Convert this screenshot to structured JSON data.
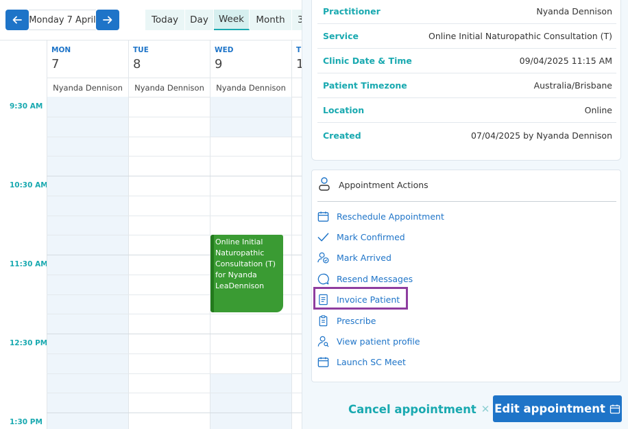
{
  "calendar": {
    "date_label": "Monday 7 April",
    "view_tabs": [
      "Today",
      "Day",
      "Week",
      "Month",
      "3"
    ],
    "active_tab": "Week",
    "days": [
      {
        "name": "MON",
        "num": "7",
        "practitioner": "Nyanda Dennison"
      },
      {
        "name": "TUE",
        "num": "8",
        "practitioner": "Nyanda Dennison"
      },
      {
        "name": "WED",
        "num": "9",
        "practitioner": "Nyanda Dennison"
      },
      {
        "name": "THU",
        "num": "1",
        "practitioner": ""
      }
    ],
    "times": [
      "9:30 AM",
      "10:30 AM",
      "11:30 AM",
      "12:30 PM",
      "1:30 PM"
    ],
    "appointment": {
      "text": "Online Initial Naturopathic Consultation (T) for Nyanda LeaDennison",
      "color": "#3a9b33"
    }
  },
  "details": {
    "rows": [
      {
        "label": "Practitioner",
        "value": "Nyanda Dennison"
      },
      {
        "label": "Service",
        "value": "Online Initial Naturopathic Consultation (T)"
      },
      {
        "label": "Clinic Date & Time",
        "value": "09/04/2025 11:15 AM"
      },
      {
        "label": "Patient Timezone",
        "value": "Australia/Brisbane"
      },
      {
        "label": "Location",
        "value": "Online"
      },
      {
        "label": "Created",
        "value": "07/04/2025 by Nyanda Dennison"
      }
    ]
  },
  "actions": {
    "title": "Appointment Actions",
    "items": [
      {
        "label": "Reschedule Appointment",
        "icon": "calendar-icon"
      },
      {
        "label": "Mark Confirmed",
        "icon": "check-icon"
      },
      {
        "label": "Mark Arrived",
        "icon": "user-check-icon"
      },
      {
        "label": "Resend Messages",
        "icon": "chat-bubble-icon"
      },
      {
        "label": "Invoice Patient",
        "icon": "invoice-icon"
      },
      {
        "label": "Prescribe",
        "icon": "clipboard-icon"
      },
      {
        "label": "View patient profile",
        "icon": "user-search-icon"
      },
      {
        "label": "Launch SC Meet",
        "icon": "calendar-video-icon"
      }
    ],
    "highlighted": "Invoice Patient",
    "highlight_color": "#8e3d9f"
  },
  "footer": {
    "cancel_label": "Cancel appointment",
    "edit_label": "Edit appointment"
  },
  "colors": {
    "primary": "#1e74c8",
    "teal": "#19a9b0",
    "appointment_green": "#3a9b33"
  }
}
